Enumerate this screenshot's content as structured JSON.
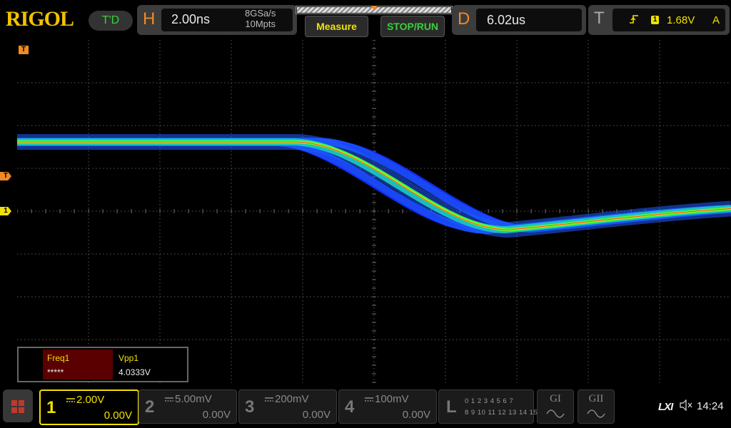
{
  "brand": {
    "logo": "RIGOL",
    "trigger_status": "T'D"
  },
  "horizontal": {
    "letter": "H",
    "timebase": "2.00ns",
    "sample_rate": "8GSa/s",
    "memory_depth": "10Mpts"
  },
  "buttons": {
    "measure": "Measure",
    "stop_run": "STOP/RUN"
  },
  "delay": {
    "letter": "D",
    "value": "6.02us"
  },
  "trigger": {
    "letter": "T",
    "source": "1",
    "level": "1.68V",
    "mode": "A",
    "edge_icon": "rising-edge-icon"
  },
  "markers": {
    "trig_pos": "T",
    "trig_level": "T",
    "ch1_offset": "1"
  },
  "measurements": [
    {
      "name": "Freq1",
      "value": "*****"
    },
    {
      "name": "Vpp1",
      "value": "4.0333V"
    }
  ],
  "channels": [
    {
      "num": "1",
      "coupling": "DC",
      "scale": "2.00V",
      "offset": "0.00V",
      "active": true
    },
    {
      "num": "2",
      "coupling": "DC",
      "scale": "5.00mV",
      "offset": "0.00V",
      "active": false
    },
    {
      "num": "3",
      "coupling": "DC",
      "scale": "200mV",
      "offset": "0.00V",
      "active": false
    },
    {
      "num": "4",
      "coupling": "DC",
      "scale": "100mV",
      "offset": "0.00V",
      "active": false
    }
  ],
  "logic": {
    "letter": "L",
    "row1": "0 1 2 3  4 5 6 7",
    "row2": "8 9 10 11 12 13 14 15"
  },
  "generators": [
    {
      "label": "GI"
    },
    {
      "label": "GII"
    }
  ],
  "status": {
    "lxi": "LXI",
    "time": "14:24"
  },
  "colors": {
    "ch1": "#f2e100",
    "accent": "#f08a24",
    "run_green": "#39d13a",
    "brand": "#f2c200"
  }
}
